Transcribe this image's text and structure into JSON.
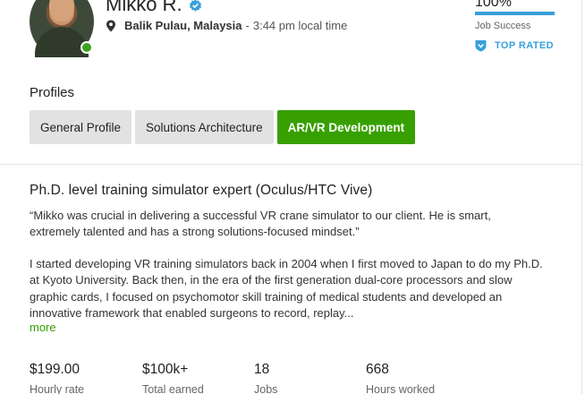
{
  "freelancer": {
    "name": "Mikko R.",
    "location_city": "Balik Pulau, Malaysia",
    "separator": "-",
    "local_time": "3:44 pm local time"
  },
  "job_success": {
    "value": "100%",
    "fraction": 1.0,
    "label": "Job Success",
    "badge": "TOP RATED"
  },
  "profiles": {
    "heading": "Profiles",
    "tabs": [
      {
        "label": "General Profile"
      },
      {
        "label": "Solutions Architecture"
      },
      {
        "label": "AR/VR Development",
        "active": true
      }
    ]
  },
  "overview": {
    "title": "Ph.D. level training simulator expert (Oculus/HTC Vive)",
    "quote": "“Mikko was crucial in delivering a successful VR crane simulator to our client. He is smart, extremely talented and has a strong solutions-focused mindset.”",
    "bio": "I started developing VR training simulators back in 2004 when I first moved to Japan to do my Ph.D. at Kyoto University. Back then, in the era of the first generation dual-core processors and slow graphic cards, I focused on psychomotor skill training of medical students and developed an innovative framework that enabled surgeons to record, replay...",
    "more_label": "more"
  },
  "stats": [
    {
      "value": "$199.00",
      "label": "Hourly rate"
    },
    {
      "value": "$100k+",
      "label": "Total earned"
    },
    {
      "value": "18",
      "label": "Jobs"
    },
    {
      "value": "668",
      "label": "Hours worked"
    }
  ],
  "colors": {
    "accent_green": "#37a000",
    "online_green": "#3ba21d",
    "info_blue": "#37a0db"
  },
  "icons": {
    "verified": "verified-check-icon",
    "location": "map-pin-icon",
    "top_rated": "shield-badge-icon"
  }
}
